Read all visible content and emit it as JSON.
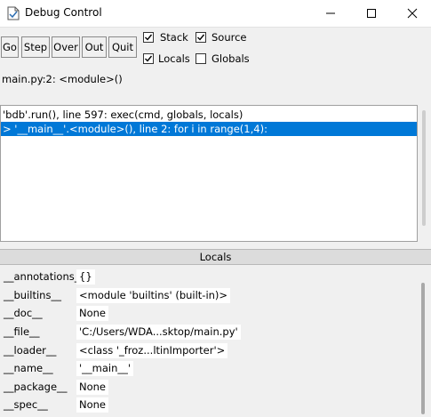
{
  "window": {
    "title": "Debug Control",
    "controls": [
      "minimize-icon",
      "maximize-icon",
      "close-icon"
    ]
  },
  "toolbar": {
    "go": "Go",
    "step": "Step",
    "over": "Over",
    "out": "Out",
    "quit": "Quit"
  },
  "options": [
    {
      "label": "Stack",
      "checked": true
    },
    {
      "label": "Source",
      "checked": true
    },
    {
      "label": "Locals",
      "checked": true
    },
    {
      "label": "Globals",
      "checked": false
    }
  ],
  "status": "main.py:2: <module>()",
  "stack": [
    {
      "text": "'bdb'.run(), line 597: exec(cmd, globals, locals)",
      "selected": false
    },
    {
      "text": "> '__main__'.<module>(), line 2: for i in range(1,4):",
      "selected": true
    }
  ],
  "locals": {
    "header": "Locals",
    "rows": [
      {
        "name": "__annotations__",
        "value": "{}"
      },
      {
        "name": "__builtins__",
        "value": "<module 'builtins' (built-in)>"
      },
      {
        "name": "__doc__",
        "value": "None"
      },
      {
        "name": "__file__",
        "value": "'C:/Users/WDA...sktop/main.py'"
      },
      {
        "name": "__loader__",
        "value": "<class '_froz...ltinImporter'>"
      },
      {
        "name": "__name__",
        "value": "'__main__'"
      },
      {
        "name": "__package__",
        "value": "None"
      },
      {
        "name": "__spec__",
        "value": "None"
      }
    ]
  },
  "colors": {
    "selection": "#0078d7",
    "window_bg": "#f0f0f0"
  }
}
